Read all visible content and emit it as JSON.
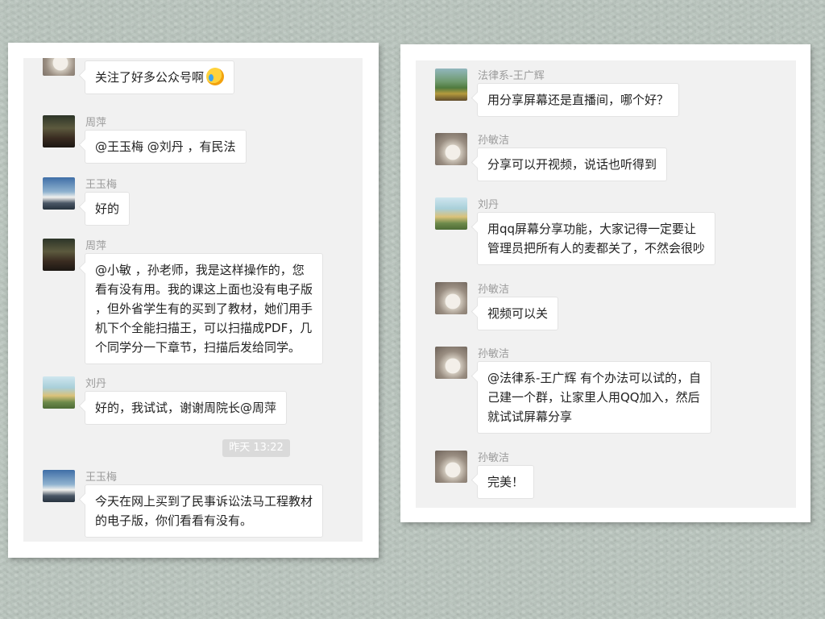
{
  "left_chat": {
    "messages": [
      {
        "sender": "",
        "text": "关注了好多公众号啊",
        "emoji": "rolling-laughing-emoji"
      },
      {
        "sender": "周萍",
        "text": "@王玉梅 @刘丹 ，有民法"
      },
      {
        "sender": "王玉梅",
        "text": "好的"
      },
      {
        "sender": "周萍",
        "lines": [
          "@小敏 ，孙老师，我是这样操作的，您",
          "看有没有用。我的课这上面也没有电子版",
          "，但外省学生有的买到了教材，她们用手",
          "机下个全能扫描王，可以扫描成PDF，几",
          "个同学分一下章节，扫描后发给同学。"
        ]
      },
      {
        "sender": "刘丹",
        "text": "好的，我试试，谢谢周院长@周萍"
      },
      {
        "sender": "王玉梅",
        "lines": [
          "今天在网上买到了民事诉讼法马工程教材",
          "的电子版，你们看看有没有。"
        ]
      }
    ],
    "timestamp": "昨天 13:22"
  },
  "right_chat": {
    "messages": [
      {
        "sender": "法律系-王广辉",
        "text": "用分享屏幕还是直播间，哪个好？"
      },
      {
        "sender": "孙敏洁",
        "text": "分享可以开视频，说话也听得到"
      },
      {
        "sender": "刘丹",
        "lines": [
          "用qq屏幕分享功能，大家记得一定要让",
          "管理员把所有人的麦都关了，不然会很吵"
        ]
      },
      {
        "sender": "孙敏洁",
        "text": "视频可以关"
      },
      {
        "sender": "孙敏洁",
        "lines": [
          "@法律系-王广辉  有个办法可以试的，自",
          "己建一个群，让家里人用QQ加入，然后",
          "就试试屏幕分享"
        ]
      },
      {
        "sender": "孙敏洁",
        "text": "完美！"
      }
    ]
  }
}
